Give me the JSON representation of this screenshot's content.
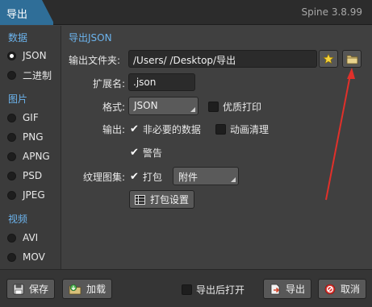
{
  "window": {
    "title": "导出",
    "app_version": "Spine 3.8.99"
  },
  "sidebar": {
    "data_header": "数据",
    "data_items": [
      {
        "label": "JSON",
        "selected": true
      },
      {
        "label": "二进制",
        "selected": false
      }
    ],
    "image_header": "图片",
    "image_items": [
      {
        "label": "GIF",
        "selected": false
      },
      {
        "label": "PNG",
        "selected": false
      },
      {
        "label": "APNG",
        "selected": false
      },
      {
        "label": "PSD",
        "selected": false
      },
      {
        "label": "JPEG",
        "selected": false
      }
    ],
    "video_header": "视频",
    "video_items": [
      {
        "label": "AVI",
        "selected": false
      },
      {
        "label": "MOV",
        "selected": false
      }
    ]
  },
  "main": {
    "section_title": "导出JSON",
    "output_folder": {
      "label": "输出文件夹:",
      "value": "/Users/   /Desktop/导出"
    },
    "extension": {
      "label": "扩展名:",
      "value": ".json"
    },
    "format": {
      "label": "格式:",
      "value": "JSON"
    },
    "pretty_print": {
      "label": "优质打印",
      "checked": false
    },
    "output": {
      "label": "输出:",
      "nonessential": {
        "label": "非必要的数据",
        "checked": true
      },
      "animation_cleanup": {
        "label": "动画清理",
        "checked": false
      },
      "warnings": {
        "label": "警告",
        "checked": true
      }
    },
    "texture_atlas": {
      "label": "纹理图集:",
      "pack": {
        "label": "打包",
        "checked": true
      },
      "pack_mode": "附件",
      "pack_settings_label": "打包设置"
    }
  },
  "footer": {
    "save_label": "保存",
    "load_label": "加载",
    "open_after_export": {
      "label": "导出后打开",
      "checked": false
    },
    "export_label": "导出",
    "cancel_label": "取消"
  },
  "colors": {
    "accent": "#6cb4ee",
    "title_tab": "#2f6e98",
    "annotation_arrow": "#e0302a"
  },
  "icons": {
    "favorite": "star-icon",
    "browse": "folder-icon",
    "pack_settings": "settings-icon",
    "save": "save-icon",
    "load": "load-icon",
    "export": "export-icon",
    "cancel": "cancel-icon"
  }
}
